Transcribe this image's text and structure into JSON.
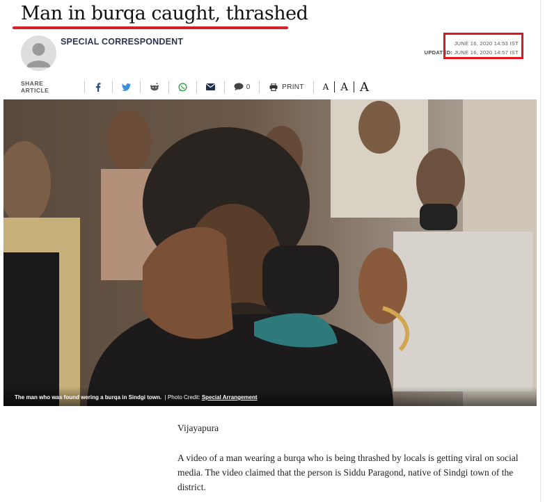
{
  "article": {
    "headline": "Man in burqa caught, thrashed",
    "author": "SPECIAL CORRESPONDENT",
    "published_label": "",
    "published": "JUNE 16, 2020 14:53 IST",
    "updated_label": "UPDATED:",
    "updated": "JUNE 16, 2020 14:57 IST"
  },
  "share": {
    "label": "SHARE ARTICLE",
    "comment_count": "0",
    "print_label": "PRINT",
    "icons": [
      "facebook-icon",
      "twitter-icon",
      "reddit-icon",
      "whatsapp-icon",
      "email-icon",
      "comment-icon",
      "print-icon"
    ]
  },
  "font_size": {
    "small": "A",
    "medium": "A",
    "large": "A"
  },
  "photo": {
    "caption": "The man who was found wering a burqa in Sindgi town.",
    "credit_label": "| Photo Credit:",
    "credit": "Special Arrangement"
  },
  "body": {
    "dateline": "Vijayapura",
    "paragraph": "A video of a man wearing a burqa who is being thrashed by locals is getting viral on social media. The video claimed that the person is Siddu Paragond, native of Sindgi town of the district."
  },
  "colors": {
    "annotation_red": "#e01520",
    "author_navy": "#2c3550"
  }
}
